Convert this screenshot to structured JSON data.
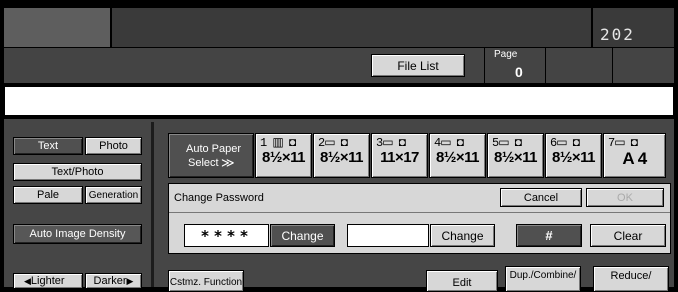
{
  "header": {
    "counter": "202"
  },
  "toolbar": {
    "file_list": "File List",
    "page_label": "Page",
    "page_value": "0"
  },
  "message": "",
  "left_panel": {
    "text": "Text",
    "photo": "Photo",
    "text_photo": "Text/Photo",
    "pale": "Pale",
    "generation": "Generation",
    "auto_density": "Auto Image Density",
    "lighter": "Lighter",
    "darker": "Darker"
  },
  "paper": {
    "auto_line1": "Auto Paper",
    "auto_line2": "Select",
    "auto_arrow": "≫",
    "trays": [
      {
        "number": "1",
        "size": "8½×11"
      },
      {
        "number": "2",
        "size": "8½×11"
      },
      {
        "number": "3",
        "size": "11×17"
      },
      {
        "number": "4",
        "size": "8½×11"
      },
      {
        "number": "5",
        "size": "8½×11"
      },
      {
        "number": "6",
        "size": "8½×11"
      },
      {
        "number": "7",
        "size": "A 4"
      }
    ]
  },
  "password": {
    "title": "Change Password",
    "cancel": "Cancel",
    "ok": "OK",
    "masked": "****",
    "change1": "Change",
    "input2": "",
    "change2": "Change",
    "hash": "#",
    "clear": "Clear"
  },
  "bottom": {
    "cstmz": "Cstmz. Function",
    "edit": "Edit",
    "dup": "Dup./Combine/",
    "reduce": "Reduce/"
  }
}
